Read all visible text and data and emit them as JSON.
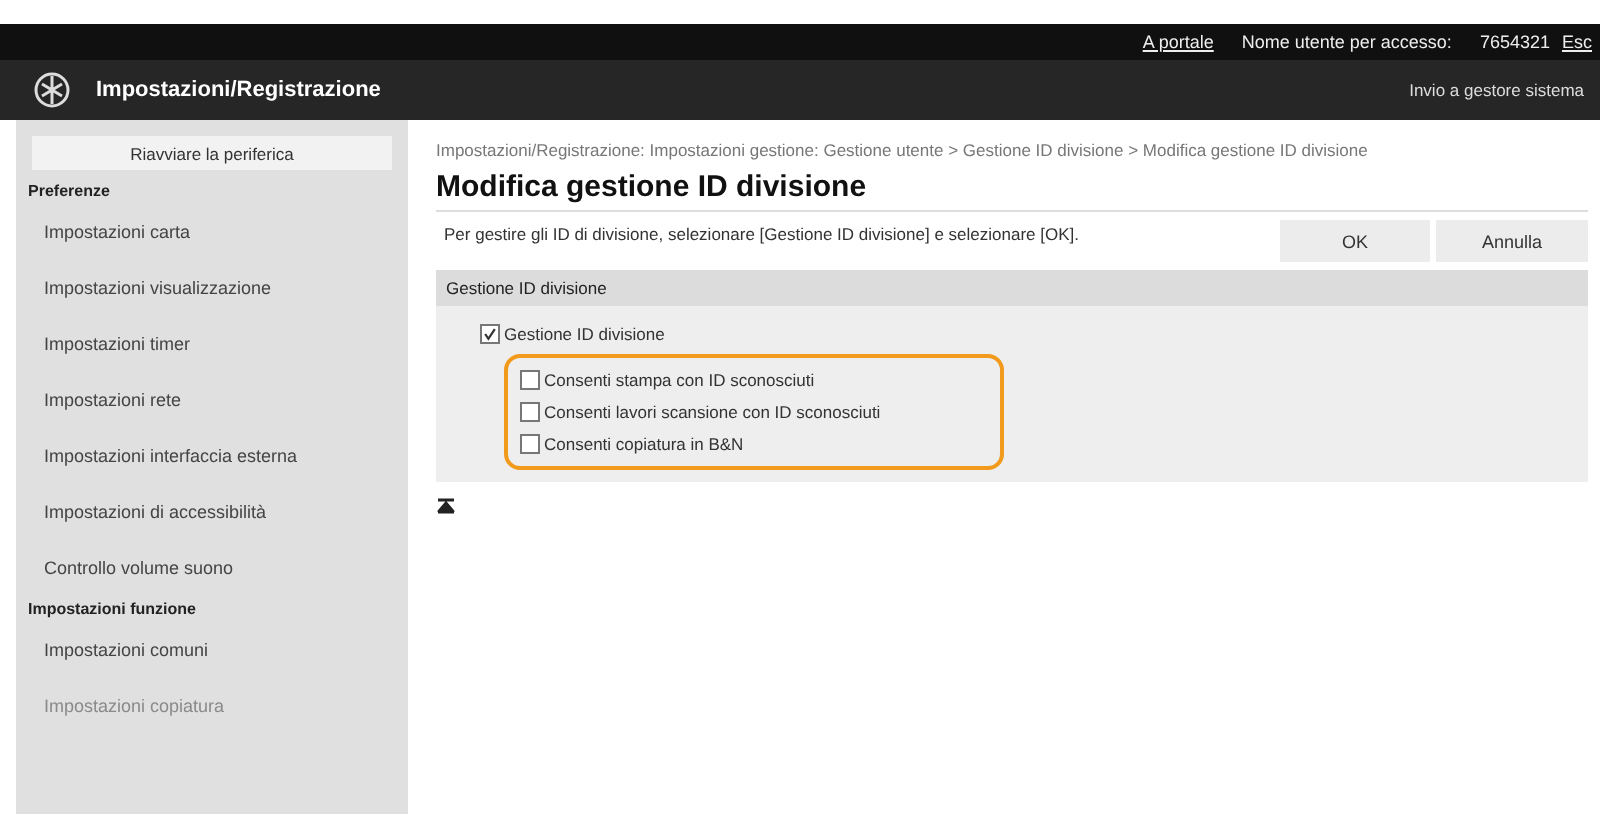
{
  "top_bar": {
    "links": [
      "A portale"
    ],
    "user_label": "Nome utente per accesso:",
    "user_id": "7654321",
    "logout": "Esc"
  },
  "header": {
    "title": "Impostazioni/Registrazione",
    "link": "Invio a gestore sistema"
  },
  "sidebar": {
    "restart_button": "Riavviare la periferica",
    "sections": [
      {
        "title": "Preferenze",
        "items": [
          {
            "label": "Impostazioni carta",
            "faded": false
          },
          {
            "label": "Impostazioni visualizzazione",
            "faded": false
          },
          {
            "label": "Impostazioni timer",
            "faded": false
          },
          {
            "label": "Impostazioni rete",
            "faded": false
          },
          {
            "label": "Impostazioni interfaccia esterna",
            "faded": false
          },
          {
            "label": "Impostazioni di accessibilità",
            "faded": false
          },
          {
            "label": "Controllo volume suono",
            "faded": false
          }
        ]
      },
      {
        "title": "Impostazioni funzione",
        "items": [
          {
            "label": "Impostazioni comuni",
            "faded": false
          },
          {
            "label": "Impostazioni copiatura",
            "faded": true
          }
        ]
      }
    ]
  },
  "breadcrumb": "Impostazioni/Registrazione: Impostazioni gestione: Gestione utente > Gestione ID divisione > Modifica gestione ID divisione",
  "page_title": "Modifica gestione ID divisione",
  "instruction": "Per gestire gli ID di divisione, selezionare [Gestione ID divisione] e selezionare [OK].",
  "buttons": [
    "OK",
    "Annulla"
  ],
  "section": {
    "title": "Gestione ID divisione",
    "main_option": {
      "label": "Gestione ID divisione",
      "checked": true
    },
    "suboptions": {
      "highlighted": true,
      "items": [
        {
          "label": "Consenti stampa con ID sconosciuti",
          "checked": false
        },
        {
          "label": "Consenti lavori scansione con ID sconosciuti",
          "checked": false
        },
        {
          "label": "Consenti copiatura in B&N",
          "checked": false
        }
      ]
    }
  }
}
